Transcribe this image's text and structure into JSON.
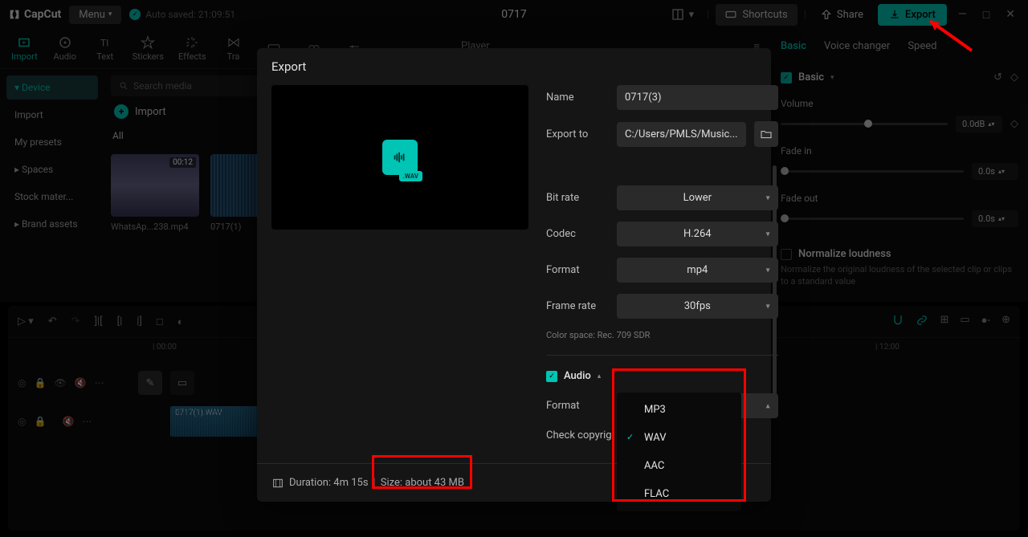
{
  "app": {
    "name": "CapCut",
    "project_title": "0717"
  },
  "topbar": {
    "menu": "Menu",
    "autosave": "Auto saved: 21:09:51",
    "shortcuts": "Shortcuts",
    "share": "Share",
    "export": "Export"
  },
  "tabs": {
    "import": "Import",
    "audio": "Audio",
    "text": "Text",
    "stickers": "Stickers",
    "effects": "Effects",
    "transitions": "Tra"
  },
  "sidebar": {
    "device": "Device",
    "import": "Import",
    "presets": "My presets",
    "spaces": "Spaces",
    "stock": "Stock mater...",
    "brand": "Brand assets"
  },
  "media": {
    "search_placeholder": "Search media",
    "import_label": "Import",
    "all": "All",
    "thumbs": [
      {
        "name": "WhatsAp...238.mp4",
        "duration": "00:12"
      },
      {
        "name": "0717(1)",
        "duration": ""
      }
    ]
  },
  "player": {
    "label": "Player"
  },
  "right_panel": {
    "tabs": {
      "basic": "Basic",
      "voice": "Voice changer",
      "speed": "Speed"
    },
    "basic_label": "Basic",
    "volume": {
      "label": "Volume",
      "value": "0.0dB"
    },
    "fade_in": {
      "label": "Fade in",
      "value": "0.0s"
    },
    "fade_out": {
      "label": "Fade out",
      "value": "0.0s"
    },
    "normalize": {
      "label": "Normalize loudness",
      "desc": "Normalize the original loudness of the selected clip or clips to a standard value"
    }
  },
  "timeline": {
    "marks": [
      "00:00",
      "00",
      "12:00"
    ],
    "clip_name": "0717(1).WAV"
  },
  "export_modal": {
    "title": "Export",
    "wav_badge": ".WAV",
    "fields": {
      "name": {
        "label": "Name",
        "value": "0717(3)"
      },
      "export_to": {
        "label": "Export to",
        "value": "C:/Users/PMLS/Music..."
      },
      "bitrate": {
        "label": "Bit rate",
        "value": "Lower"
      },
      "codec": {
        "label": "Codec",
        "value": "H.264"
      },
      "format": {
        "label": "Format",
        "value": "mp4"
      },
      "frame_rate": {
        "label": "Frame rate",
        "value": "30fps"
      },
      "color_space": "Color space: Rec. 709 SDR",
      "audio_section": "Audio",
      "audio_format": {
        "label": "Format",
        "value": "WAV"
      },
      "check_copyright": "Check copyrig"
    },
    "dropdown": [
      "MP3",
      "WAV",
      "AAC",
      "FLAC"
    ],
    "dropdown_selected": "WAV",
    "footer": {
      "duration": "Duration: 4m 15s",
      "size": "Size: about 43 MB"
    }
  }
}
